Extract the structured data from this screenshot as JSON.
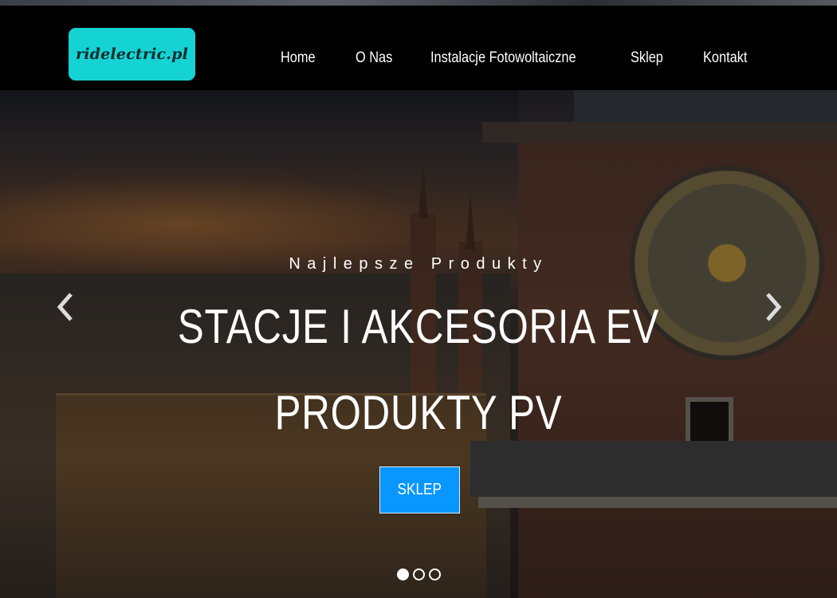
{
  "brand": {
    "logo_text": "ridelectric.pl",
    "logo_color": "#16d3d3"
  },
  "nav": {
    "items": [
      {
        "label": "Home"
      },
      {
        "label": "O Nas"
      },
      {
        "label": "Instalacje Fotowoltaiczne"
      },
      {
        "label": "Sklep"
      },
      {
        "label": "Kontakt"
      }
    ]
  },
  "hero": {
    "subtitle": "Najlepsze Produkty",
    "headline_line1": "STACJE I AKCESORIA EV",
    "headline_line2": "PRODUKTY PV",
    "cta_label": "SKLEP",
    "cta_color": "#0a96ff",
    "prev_icon": "chevron-left-icon",
    "next_icon": "chevron-right-icon",
    "slides_total": 3,
    "active_slide": 1
  }
}
